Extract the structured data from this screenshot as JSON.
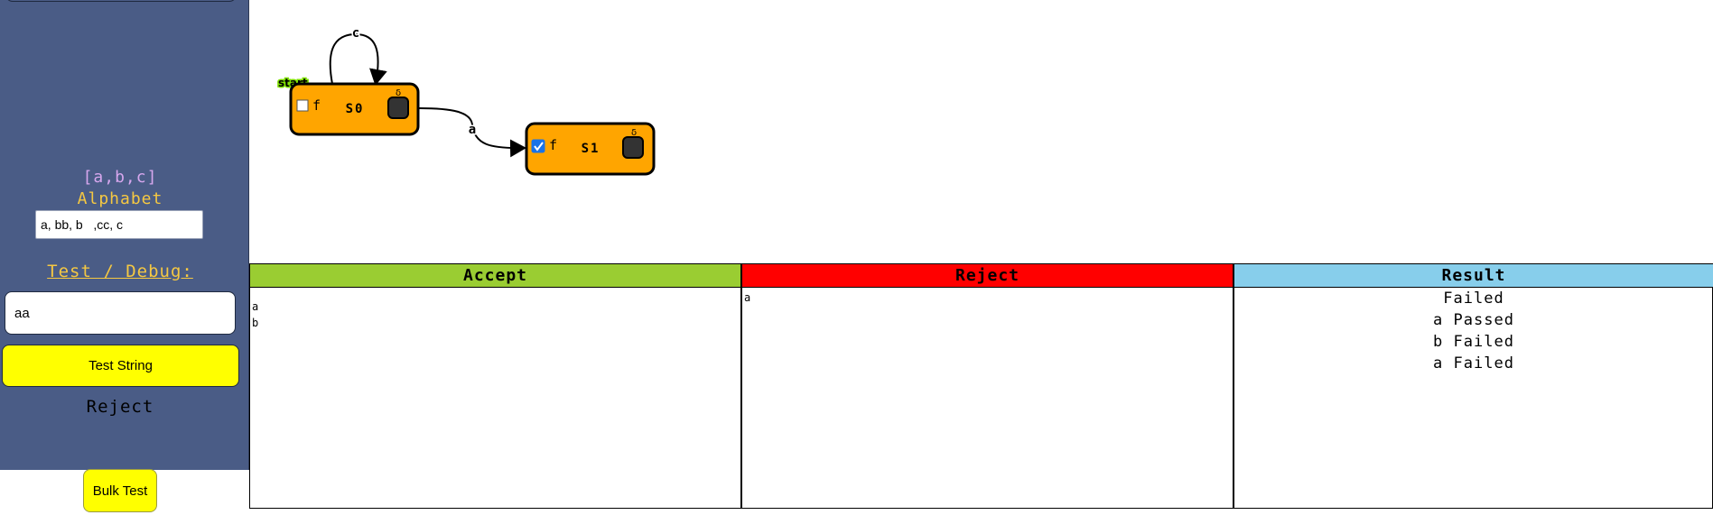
{
  "sidebar": {
    "alphabet_set": "[a,b,c]",
    "alphabet_label": "Alphabet",
    "alphabet_value": "a, bb, b   ,cc, c",
    "test_debug_label": "Test / Debug:",
    "test_input_value": "aa",
    "test_button_label": "Test String",
    "test_result": "Reject",
    "bulk_test_label": "Bulk Test"
  },
  "diagram": {
    "start_label": "start",
    "states": [
      {
        "name": "S0",
        "final_label": "f",
        "final_checked": false,
        "delete_label": "δ"
      },
      {
        "name": "S1",
        "final_label": "f",
        "final_checked": true,
        "delete_label": "δ"
      }
    ],
    "transitions": [
      {
        "from": "S0",
        "to": "S0",
        "label": "c"
      },
      {
        "from": "S0",
        "to": "S1",
        "label": "a"
      }
    ]
  },
  "results": {
    "accept_header": "Accept",
    "reject_header": "Reject",
    "result_header": "Result",
    "accept_items": [
      "a",
      "b"
    ],
    "reject_items": [
      "a"
    ],
    "result_items": [
      "Failed",
      "a Passed",
      "b Failed",
      "a Failed"
    ]
  },
  "colors": {
    "sidebar": "#4a5c86",
    "state_fill": "#ffa500",
    "accept": "#9acd32",
    "reject": "#ff0000",
    "result": "#87ceeb",
    "button": "#ffff00"
  }
}
